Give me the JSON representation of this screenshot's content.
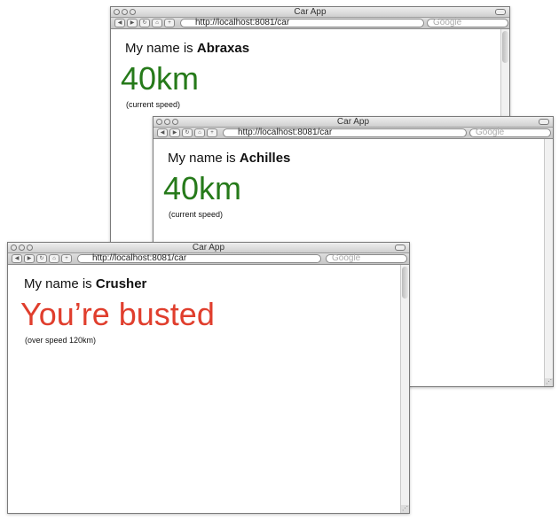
{
  "windows": [
    {
      "id": "abraxas",
      "title": "Car App",
      "url": "http://localhost:8081/car",
      "search_placeholder": "Google",
      "name_prefix": "My name is",
      "name": "Abraxas",
      "status": "40km",
      "status_color": "#267a1a",
      "note": "(current speed)"
    },
    {
      "id": "achilles",
      "title": "Car App",
      "url": "http://localhost:8081/car",
      "search_placeholder": "Google",
      "name_prefix": "My name is",
      "name": "Achilles",
      "status": "40km",
      "status_color": "#267a1a",
      "note": "(current speed)"
    },
    {
      "id": "crusher",
      "title": "Car App",
      "url": "http://localhost:8081/car",
      "search_placeholder": "Google",
      "name_prefix": "My name is",
      "name": "Crusher",
      "status": "You’re busted",
      "status_color": "#e03e2d",
      "note": "(over speed 120km)"
    }
  ]
}
